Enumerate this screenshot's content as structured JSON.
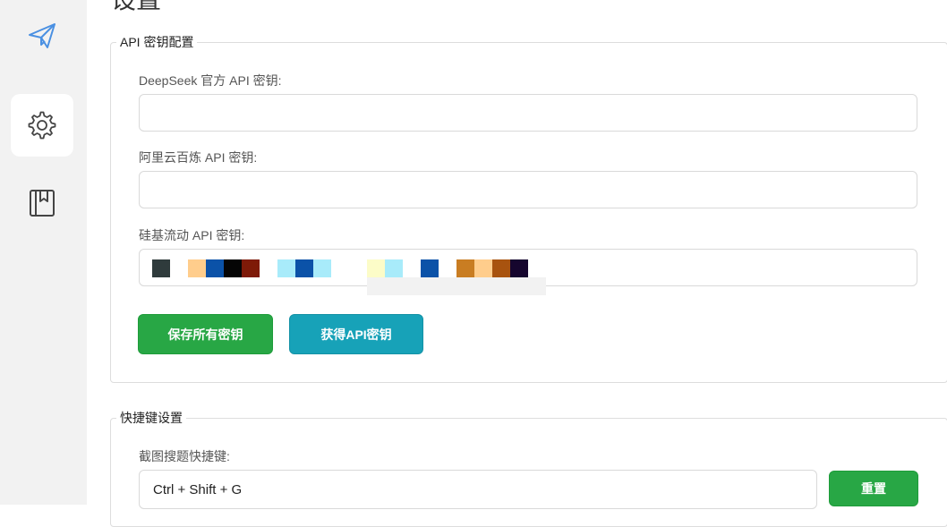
{
  "sidebar": {
    "items": [
      {
        "icon": "paper-plane-icon",
        "active": false
      },
      {
        "icon": "gear-icon",
        "active": true
      },
      {
        "icon": "bookmark-book-icon",
        "active": false
      }
    ]
  },
  "page": {
    "title": "设置"
  },
  "api_section": {
    "legend": "API 密钥配置",
    "deepseek": {
      "label": "DeepSeek 官方 API 密钥:",
      "value": ""
    },
    "aliyun": {
      "label": "阿里云百炼 API 密钥:",
      "value": ""
    },
    "siliconflow": {
      "label": "硅基流动 API 密钥:",
      "value": "(masked)"
    },
    "save_button": "保存所有密钥",
    "get_key_button": "获得API密钥"
  },
  "hotkey_section": {
    "legend": "快捷键设置",
    "screenshot_search": {
      "label": "截图搜题快捷键:",
      "value": "Ctrl + Shift + G"
    },
    "reset_button": "重置"
  },
  "colors": {
    "sidebar_bg": "#f2f2f2",
    "accent_icon": "#4a90e2",
    "success": "#28a745",
    "info": "#17a2b8"
  }
}
